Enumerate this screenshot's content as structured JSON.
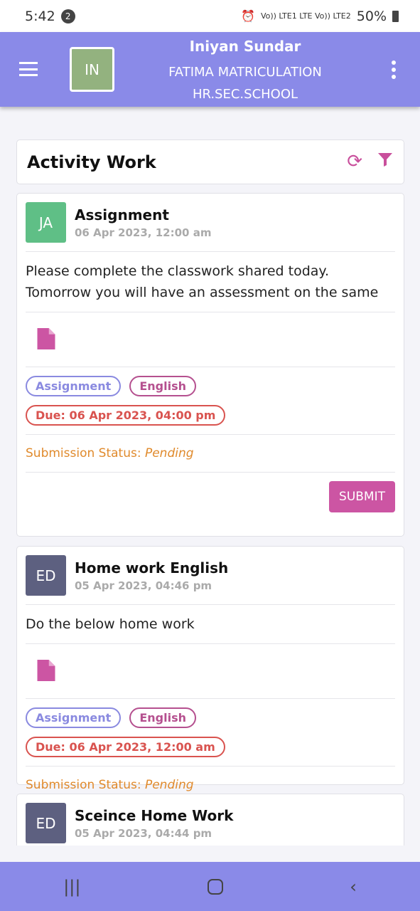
{
  "status_bar": {
    "time": "5:42",
    "notifications": "2",
    "network": "Vo)) LTE1 LTE  Vo)) LTE2",
    "battery": "50%"
  },
  "header": {
    "avatar_initials": "IN",
    "user_name": "Iniyan Sundar",
    "school_line1": "FATIMA MATRICULATION",
    "school_line2": "HR.SEC.SCHOOL"
  },
  "page": {
    "title": "Activity Work"
  },
  "colors": {
    "header": "#8a8ae8",
    "accent": "#cc55a3",
    "due": "#d9534f",
    "status": "#e08a2c"
  },
  "posts": [
    {
      "initials": "JA",
      "avatar_color": "#5fbf86",
      "title": "Assignment",
      "date": "06 Apr 2023, 12:00 am",
      "body": "Please complete the classwork shared today. Tomorrow you will have an assessment on the same",
      "tags": [
        "Assignment",
        "English"
      ],
      "due": "Due: 06 Apr 2023, 04:00 pm",
      "status_label": "Submission Status:",
      "status_value": "Pending",
      "submit_label": "SUBMIT"
    },
    {
      "initials": "ED",
      "avatar_color": "#5d6080",
      "title": "Home work English",
      "date": "05 Apr 2023, 04:46 pm",
      "body": "Do the below home work",
      "tags": [
        "Assignment",
        "English"
      ],
      "due": "Due: 06 Apr 2023, 12:00 am",
      "status_label": "Submission Status:",
      "status_value": "Pending"
    },
    {
      "initials": "ED",
      "avatar_color": "#5d6080",
      "title": "Sceince Home Work",
      "date": "05 Apr 2023, 04:44 pm"
    }
  ]
}
